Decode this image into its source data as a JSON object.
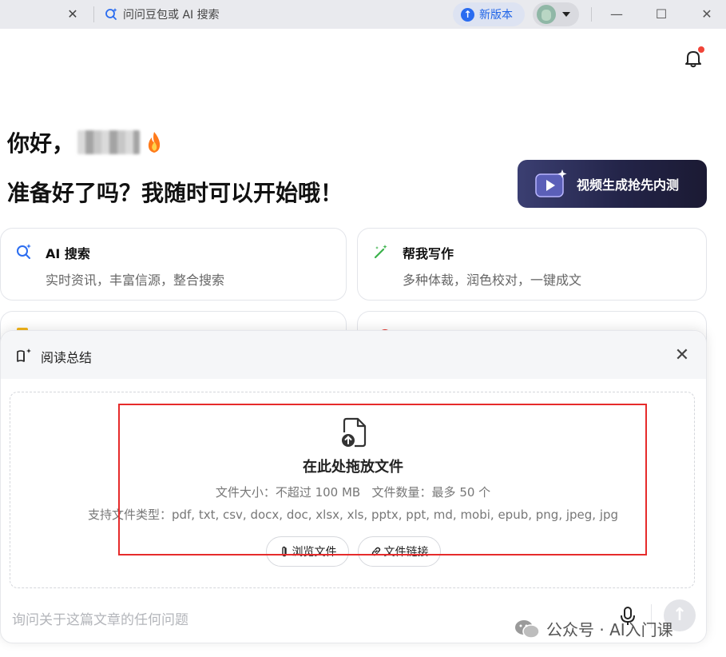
{
  "titlebar": {
    "tab_close": "✕",
    "search_tab_label": "问问豆包或 AI 搜索",
    "new_version_label": "新版本",
    "minimize": "—",
    "maximize": "☐",
    "close": "✕"
  },
  "greeting": {
    "hello": "你好，",
    "ready": "准备好了吗？我随时可以开始哦！"
  },
  "promo": {
    "label": "视频生成抢先内测"
  },
  "cards": [
    {
      "title": "AI 搜索",
      "subtitle": "实时资讯，丰富信源，整合搜索"
    },
    {
      "title": "帮我写作",
      "subtitle": "多种体裁，润色校对，一键成文"
    }
  ],
  "panel": {
    "title": "阅读总结",
    "close": "✕",
    "drop_title": "在此处拖放文件",
    "size_limit": "文件大小：不超过 100 MB",
    "count_limit": "文件数量：最多 50 个",
    "types": "支持文件类型：pdf, txt, csv, docx, doc, xlsx, xls, pptx, ppt, md, mobi, epub, png, jpeg, jpg",
    "browse_label": "浏览文件",
    "link_label": "文件链接",
    "ask_placeholder": "询问关于这篇文章的任何问题",
    "send": "↑"
  },
  "watermark": {
    "text": "公众号 · AI入门课"
  },
  "colors": {
    "accent": "#1f64e8",
    "annotation_red": "#e62b2b",
    "promo_bg": "#232448"
  }
}
